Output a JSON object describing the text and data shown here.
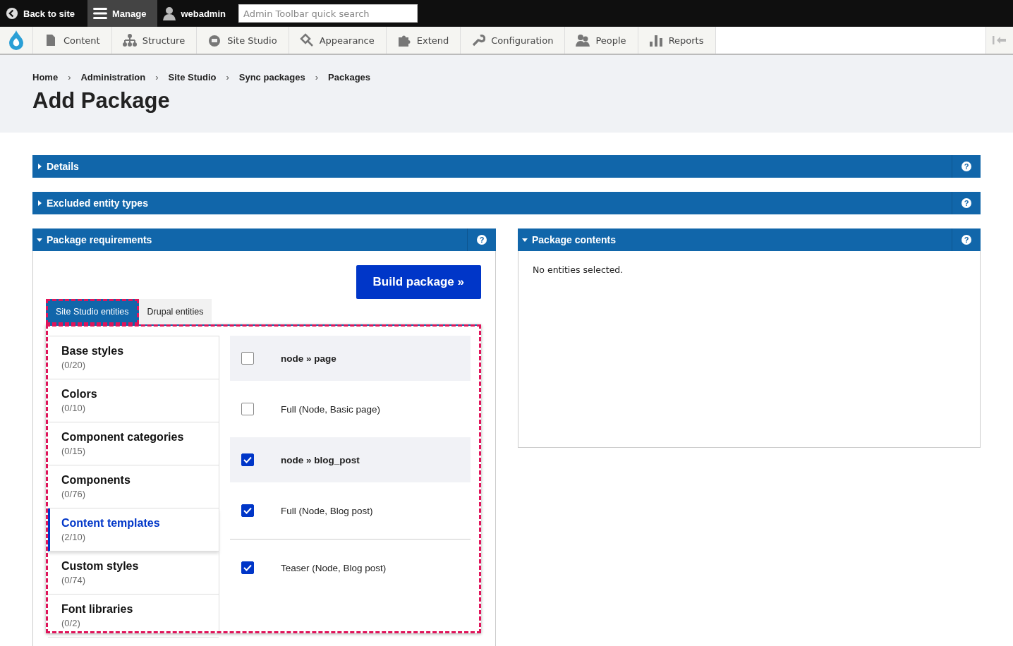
{
  "admin_bar": {
    "back": "Back to site",
    "manage": "Manage",
    "user": "webadmin",
    "search": {
      "placeholder": "Admin Toolbar quick search"
    }
  },
  "menu": [
    {
      "label": "Content"
    },
    {
      "label": "Structure"
    },
    {
      "label": "Site Studio"
    },
    {
      "label": "Appearance"
    },
    {
      "label": "Extend"
    },
    {
      "label": "Configuration"
    },
    {
      "label": "People"
    },
    {
      "label": "Reports"
    }
  ],
  "breadcrumb": [
    "Home",
    "Administration",
    "Site Studio",
    "Sync packages",
    "Packages"
  ],
  "breadcrumb_separator": "›",
  "page_title": "Add Package",
  "collapsed_sections": [
    {
      "title": "Details",
      "expanded": false,
      "help": "?"
    },
    {
      "title": "Excluded entity types",
      "expanded": false,
      "help": "?"
    }
  ],
  "requirements": {
    "title": "Package requirements",
    "expanded": true,
    "help": "?",
    "build_button": "Build package »",
    "tabs": [
      {
        "label": "Site Studio entities",
        "selected": true
      },
      {
        "label": "Drupal entities",
        "selected": false
      }
    ],
    "focus_outline": true,
    "categories": [
      {
        "name": "Base styles",
        "count": "(0/20)",
        "selected": false
      },
      {
        "name": "Colors",
        "count": "(0/10)",
        "selected": false
      },
      {
        "name": "Component categories",
        "count": "(0/15)",
        "selected": false
      },
      {
        "name": "Components",
        "count": "(0/76)",
        "selected": false
      },
      {
        "name": "Content templates",
        "count": "(2/10)",
        "selected": true
      },
      {
        "name": "Custom styles",
        "count": "(0/74)",
        "selected": false
      },
      {
        "name": "Font libraries",
        "count": "(0/2)",
        "selected": false
      }
    ],
    "entities": [
      {
        "kind": "group",
        "label": "node » page",
        "checked": false
      },
      {
        "kind": "item",
        "label": "Full (Node, Basic page)",
        "checked": false
      },
      {
        "kind": "group",
        "label": "node » blog_post",
        "checked": true
      },
      {
        "kind": "item",
        "label": "Full (Node, Blog post)",
        "checked": true
      },
      {
        "kind": "item",
        "label": "Teaser (Node, Blog post)",
        "checked": true
      }
    ]
  },
  "contents": {
    "title": "Package contents",
    "expanded": true,
    "help": "?",
    "empty_text": "No entities selected."
  }
}
